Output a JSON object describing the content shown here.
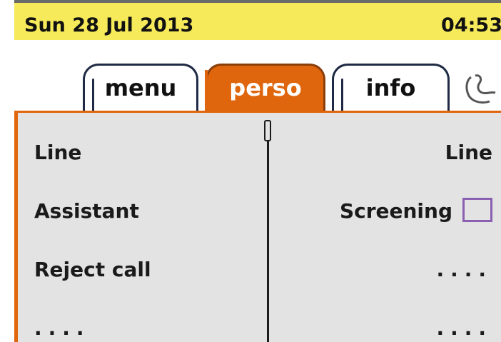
{
  "status": {
    "date": "Sun 28 Jul 2013",
    "time": "04:53"
  },
  "tabs": [
    {
      "label": "menu",
      "selected": false
    },
    {
      "label": "perso",
      "selected": true
    },
    {
      "label": "info",
      "selected": false
    }
  ],
  "left_column": [
    "Line",
    "Assistant",
    "Reject call",
    "...."
  ],
  "right_column": [
    "Line",
    "Screening",
    "....",
    "...."
  ],
  "screening_checked": false,
  "colors": {
    "status_bg": "#f7ea5a",
    "accent": "#e0660e",
    "panel_bg": "#e3e3e3"
  }
}
